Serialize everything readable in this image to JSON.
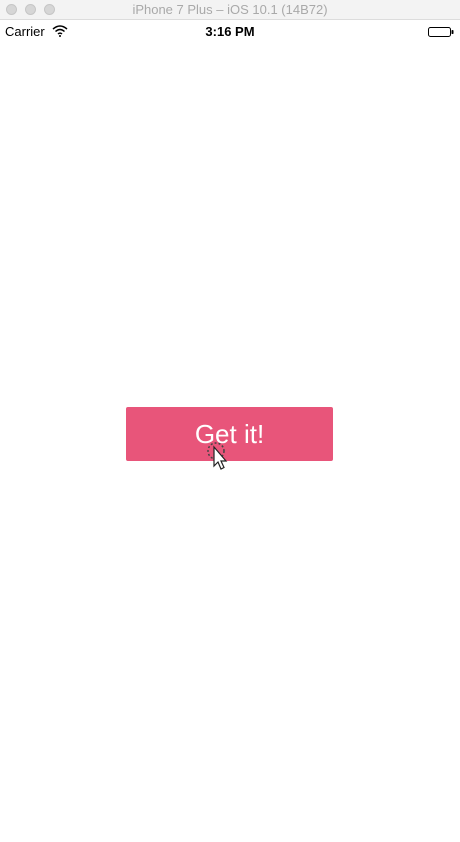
{
  "window": {
    "title": "iPhone 7 Plus – iOS 10.1 (14B72)"
  },
  "status_bar": {
    "carrier": "Carrier",
    "time": "3:16 PM",
    "wifi_icon": "wifi-icon",
    "battery_icon": "battery-icon"
  },
  "main": {
    "button_label": "Get it!",
    "button_color": "#e8557a",
    "button_text_color": "#ffffff",
    "cursor_icon": "tap-pointer-icon"
  }
}
